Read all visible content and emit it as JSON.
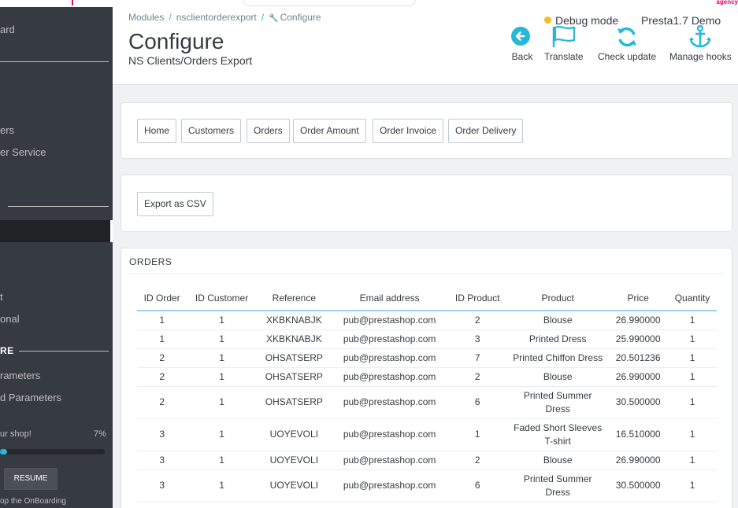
{
  "sidebar": {
    "items_top": [
      "ard"
    ],
    "items_mid": [
      "ers",
      "er Service"
    ],
    "items_low": [
      "t",
      "onal"
    ],
    "section_label": "RE",
    "items_conf": [
      "rameters",
      "d Parameters"
    ],
    "onboarding": {
      "label": "ur shop!",
      "percent_text": "7%",
      "progress": 0.07,
      "resume_label": "RESUME",
      "stop_label": "op the OnBoarding"
    }
  },
  "header": {
    "breadcrumb": [
      "Modules",
      "nsclientorderexport",
      "Configure"
    ],
    "title": "Configure",
    "subtitle": "NS Clients/Orders Export",
    "debug_label": "Debug mode",
    "shop_name": "Presta1.7 Demo",
    "toolbar": [
      {
        "label": "Back",
        "icon": "arrow-left-circle-icon"
      },
      {
        "label": "Translate",
        "icon": "flag-icon"
      },
      {
        "label": "Check update",
        "icon": "refresh-icon"
      },
      {
        "label": "Manage hooks",
        "icon": "anchor-icon"
      }
    ],
    "agency_text": "agency"
  },
  "nav_buttons": [
    "Home",
    "Customers",
    "Orders",
    "Order Amount",
    "Order Invoice",
    "Order Delivery"
  ],
  "export_button": "Export as CSV",
  "orders": {
    "heading": "ORDERS",
    "columns": [
      "ID Order",
      "ID Customer",
      "Reference",
      "Email address",
      "ID Product",
      "Product",
      "Price",
      "Quantity"
    ],
    "rows": [
      [
        "1",
        "1",
        "XKBKNABJK",
        "pub@prestashop.com",
        "2",
        "Blouse",
        "26.990000",
        "1"
      ],
      [
        "1",
        "1",
        "XKBKNABJK",
        "pub@prestashop.com",
        "3",
        "Printed Dress",
        "25.990000",
        "1"
      ],
      [
        "2",
        "1",
        "OHSATSERP",
        "pub@prestashop.com",
        "7",
        "Printed Chiffon Dress",
        "20.501236",
        "1"
      ],
      [
        "2",
        "1",
        "OHSATSERP",
        "pub@prestashop.com",
        "2",
        "Blouse",
        "26.990000",
        "1"
      ],
      [
        "2",
        "1",
        "OHSATSERP",
        "pub@prestashop.com",
        "6",
        "Printed Summer Dress",
        "30.500000",
        "1"
      ],
      [
        "3",
        "1",
        "UOYEVOLI",
        "pub@prestashop.com",
        "1",
        "Faded Short Sleeves T-shirt",
        "16.510000",
        "1"
      ],
      [
        "3",
        "1",
        "UOYEVOLI",
        "pub@prestashop.com",
        "2",
        "Blouse",
        "26.990000",
        "1"
      ],
      [
        "3",
        "1",
        "UOYEVOLI",
        "pub@prestashop.com",
        "6",
        "Printed Summer Dress",
        "30.500000",
        "1"
      ]
    ]
  },
  "colors": {
    "sidebar_bg": "#363a41",
    "accent": "#25b9d7",
    "brand": "#df0067",
    "table_header_border": "#a0d0eb"
  }
}
